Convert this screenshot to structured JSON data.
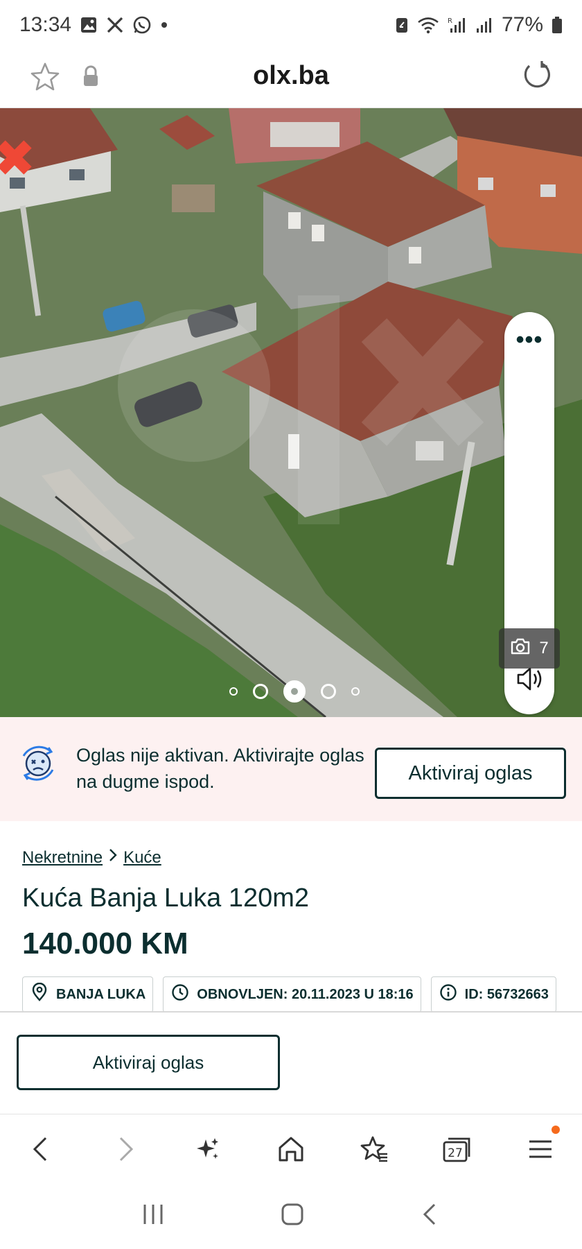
{
  "status_bar": {
    "time": "13:34",
    "battery": "77%",
    "left_icons": [
      "gallery-icon",
      "x-icon",
      "whatsapp-icon",
      "dot-icon"
    ],
    "right_icons": [
      "battery-saver-icon",
      "wifi-icon",
      "signal-r-icon",
      "signal-icon",
      "battery-icon"
    ]
  },
  "browser": {
    "domain": "olx.ba",
    "icons": [
      "star-icon",
      "lock-icon",
      "reload-icon"
    ]
  },
  "gallery": {
    "photo_count": "7",
    "more_label": "•••",
    "active_index": 2,
    "dot_count": 5
  },
  "banner": {
    "message": "Oglas nije aktivan. Aktivirajte oglas na dugme ispod.",
    "button_label": "Aktiviraj oglas"
  },
  "listing": {
    "breadcrumb": [
      "Nekretnine",
      "Kuće"
    ],
    "title": "Kuća Banja Luka 120m2",
    "price": "140.000 KM",
    "location": "BANJA LUKA",
    "updated": "OBNOVLJEN: 20.11.2023 U 18:16",
    "id": "ID: 56732663"
  },
  "bottom": {
    "activate_label": "Aktiviraj oglas"
  },
  "toolbar": {
    "tabs_count": "27",
    "icons": [
      "back-icon",
      "forward-icon",
      "sparkle-icon",
      "home-icon",
      "bookmarks-icon",
      "tabs-icon",
      "menu-icon"
    ]
  },
  "colors": {
    "brand_dark": "#0b2e2f",
    "banner_bg": "#fdf1f1",
    "notification": "#f56a1c"
  }
}
